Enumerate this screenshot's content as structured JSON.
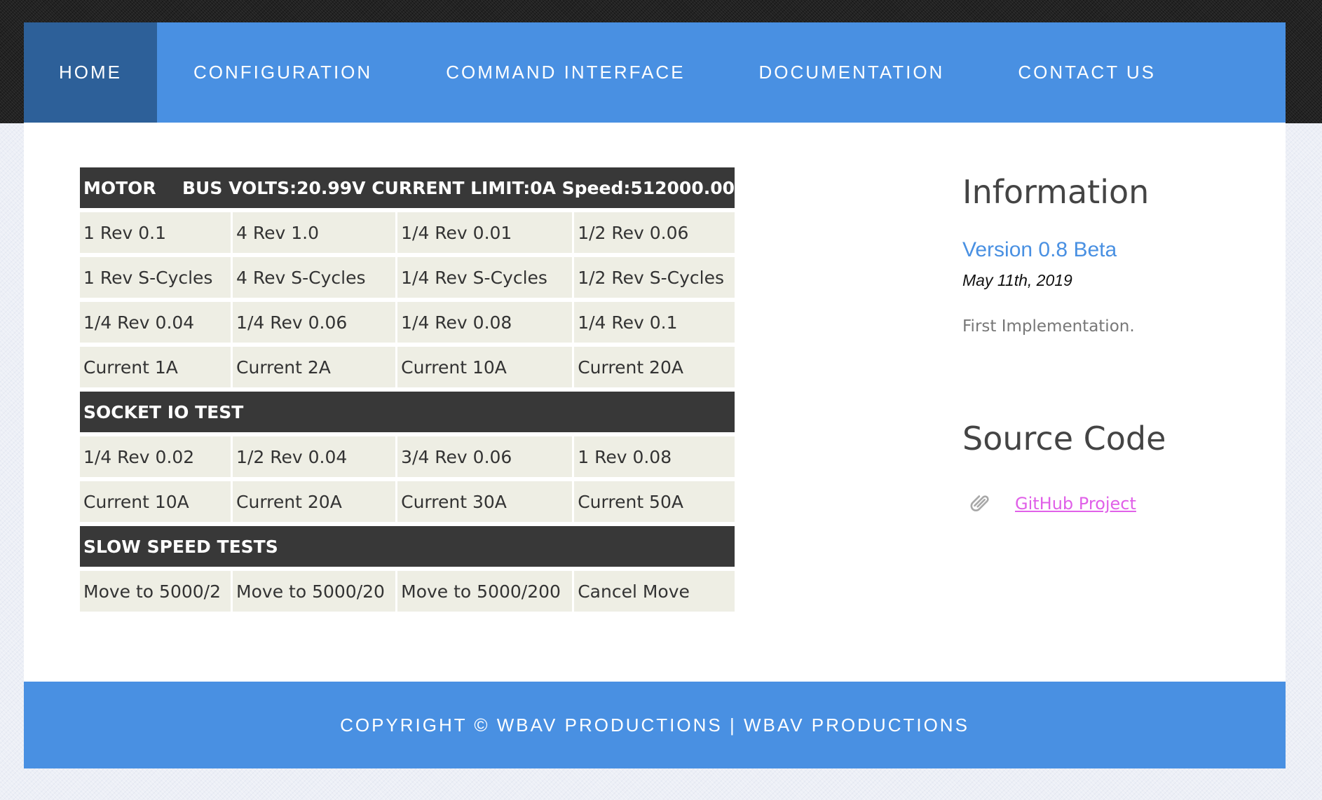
{
  "nav": {
    "items": [
      {
        "label": "HOME"
      },
      {
        "label": "CONFIGURATION"
      },
      {
        "label": "COMMAND INTERFACE"
      },
      {
        "label": "DOCUMENTATION"
      },
      {
        "label": "CONTACT US"
      }
    ],
    "active": "HOME"
  },
  "motor": {
    "header_label": "MOTOR",
    "status": "BUS VOLTS:20.99V CURRENT LIMIT:0A Speed:512000.00",
    "rows": [
      [
        "1 Rev 0.1",
        "4 Rev 1.0",
        "1/4 Rev 0.01",
        "1/2 Rev 0.06"
      ],
      [
        "1 Rev S-Cycles",
        "4 Rev S-Cycles",
        "1/4 Rev S-Cycles",
        "1/2 Rev S-Cycles"
      ],
      [
        "1/4 Rev 0.04",
        "1/4 Rev 0.06",
        "1/4 Rev 0.08",
        "1/4 Rev 0.1"
      ],
      [
        "Current 1A",
        "Current 2A",
        "Current 10A",
        "Current 20A"
      ]
    ]
  },
  "socket_io": {
    "header_label": "SOCKET IO TEST",
    "rows": [
      [
        "1/4 Rev 0.02",
        "1/2 Rev 0.04",
        "3/4 Rev 0.06",
        "1 Rev 0.08"
      ],
      [
        "Current 10A",
        "Current 20A",
        "Current 30A",
        "Current 50A"
      ]
    ]
  },
  "slow_speed": {
    "header_label": "SLOW SPEED TESTS",
    "rows": [
      [
        "Move to 5000/2",
        "Move to 5000/20",
        "Move to 5000/200",
        "Cancel Move"
      ]
    ]
  },
  "sidebar": {
    "info_title": "Information",
    "version": "Version 0.8 Beta",
    "date": "May 11th, 2019",
    "note": "First Implementation.",
    "source_title": "Source Code",
    "github_label": "GitHub Project",
    "github_icon": "paperclip-icon"
  },
  "footer": {
    "text": "COPYRIGHT © WBAV PRODUCTIONS | WBAV PRODUCTIONS"
  },
  "colors": {
    "nav_bg": "#4990e2",
    "nav_active_bg": "#2d6099",
    "header_row_bg": "#383838",
    "cell_bg": "#eeeee4",
    "link_color": "#e060e8",
    "version_color": "#4990e2"
  }
}
